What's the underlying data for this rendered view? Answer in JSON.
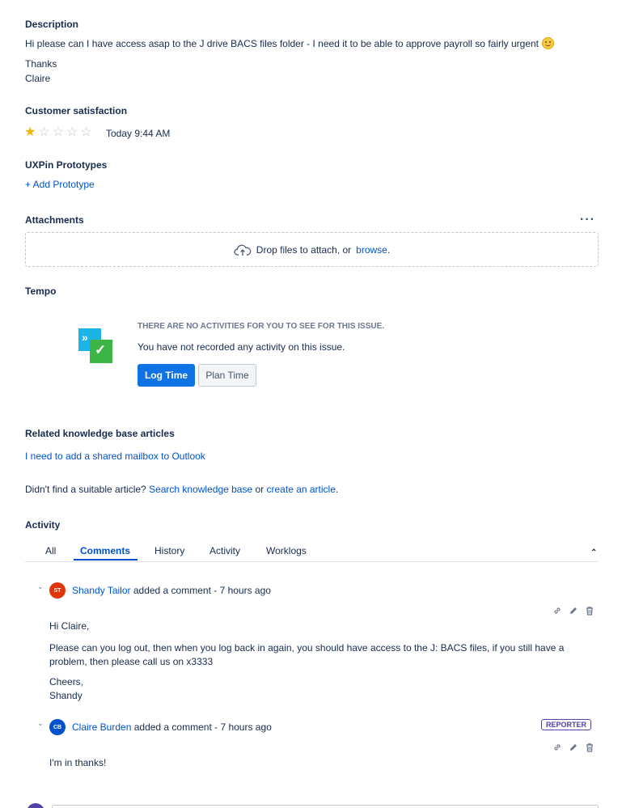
{
  "description": {
    "title": "Description",
    "body": "Hi please can I have access asap to the J drive BACS files folder - I need it to be able to approve payroll so fairly urgent",
    "thanks": "Thanks",
    "signature": "Claire"
  },
  "satisfaction": {
    "title": "Customer satisfaction",
    "rating": 1,
    "max_rating": 5,
    "timestamp": "Today 9:44 AM"
  },
  "uxpin": {
    "title": "UXPin Prototypes",
    "add_label": "+ Add Prototype"
  },
  "attachments": {
    "title": "Attachments",
    "drop_text": "Drop files to attach, or",
    "browse_label": "browse",
    "browse_suffix": "."
  },
  "tempo": {
    "title": "Tempo",
    "heading": "THERE ARE NO ACTIVITIES FOR YOU TO SEE FOR THIS ISSUE.",
    "message": "You have not recorded any activity on this issue.",
    "log_time_label": "Log Time",
    "plan_time_label": "Plan Time"
  },
  "knowledge_base": {
    "title": "Related knowledge base articles",
    "article_link": "I need to add a shared mailbox to Outlook",
    "prompt": "Didn't find a suitable article?",
    "search_link": "Search knowledge base",
    "or_text": "or",
    "create_link": "create an article",
    "period": "."
  },
  "activity": {
    "title": "Activity",
    "tabs": [
      {
        "label": "All",
        "active": false
      },
      {
        "label": "Comments",
        "active": true
      },
      {
        "label": "History",
        "active": false
      },
      {
        "label": "Activity",
        "active": false
      },
      {
        "label": "Worklogs",
        "active": false
      }
    ],
    "comments": [
      {
        "initials": "ST",
        "avatar_color": "#de350b",
        "author": "Shandy Tailor",
        "meta": "added a comment - 7 hours ago",
        "lines": [
          "Hi Claire,",
          "Please can you log out, then when you log back in again, you should have access to the J: BACS files, if you still have a problem, then please call us on x3333",
          "Cheers,",
          "Shandy"
        ]
      },
      {
        "initials": "CB",
        "avatar_color": "#0052cc",
        "author": "Claire Burden",
        "meta": "added a comment - 7 hours ago",
        "badge": "REPORTER",
        "lines": [
          "I'm in thanks!"
        ]
      }
    ]
  },
  "colors": {
    "link": "#0052cc",
    "primary_button": "#0f72e5",
    "star_filled": "#f5b400",
    "reporter_badge": "#5243aa"
  },
  "icons": [
    "emoji-smile-icon",
    "star-icon",
    "cloud-upload-icon",
    "tempo-logo-icon",
    "chevron-down-icon",
    "chevron-up-icon",
    "more-icon",
    "link-icon",
    "edit-icon",
    "trash-icon"
  ]
}
